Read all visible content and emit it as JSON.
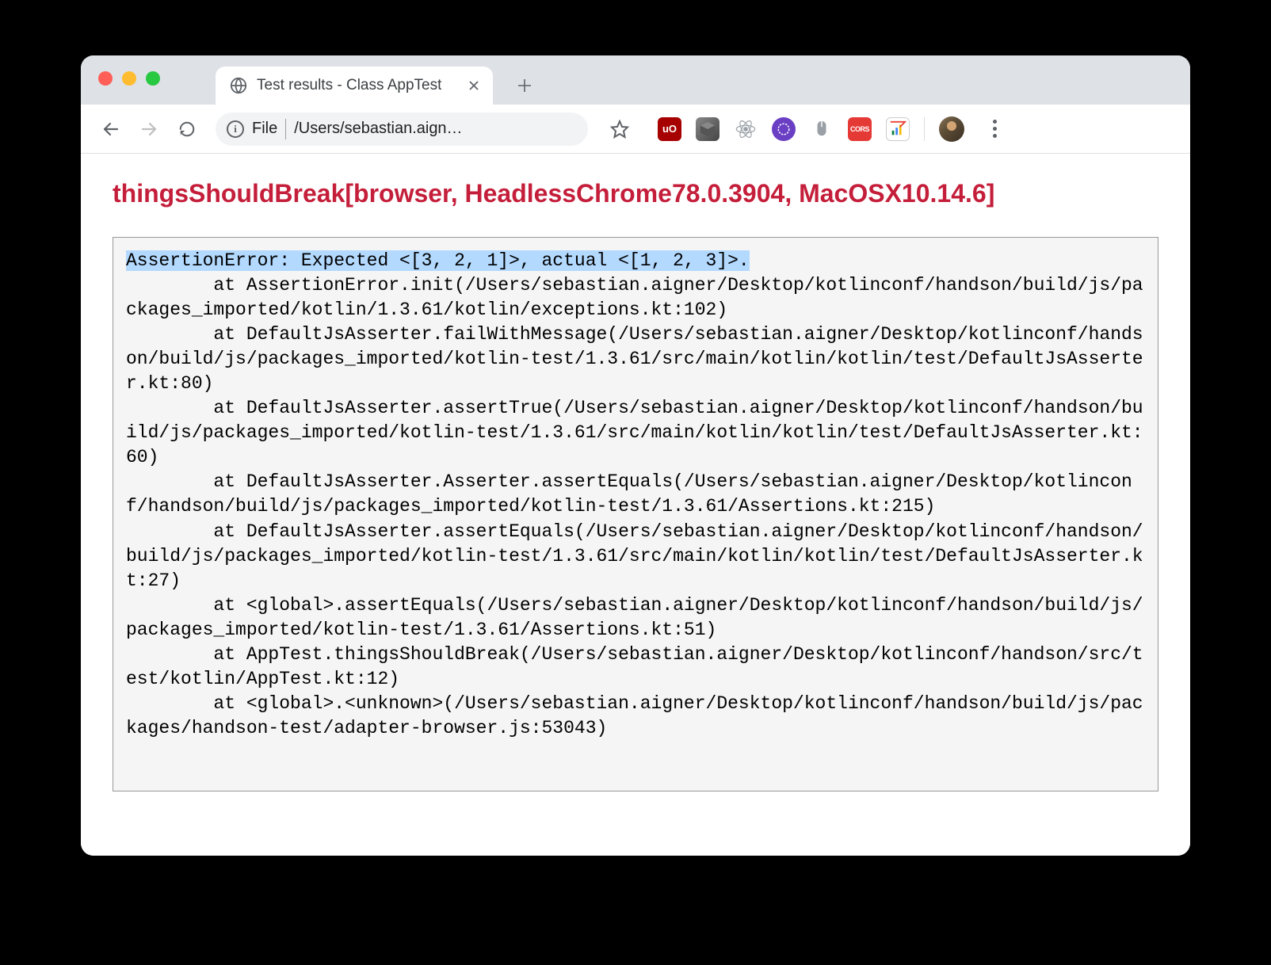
{
  "tab": {
    "title": "Test results - Class AppTest"
  },
  "address": {
    "prefix": "File",
    "url": "/Users/sebastian.aign…"
  },
  "extensions": {
    "ublock_label": "uO",
    "cors_label": "CORS"
  },
  "page": {
    "heading": "thingsShouldBreak[browser, HeadlessChrome78.0.3904, MacOSX10.14.6]",
    "error_line": "AssertionError: Expected <[3, 2, 1]>, actual <[1, 2, 3]>.",
    "stack": "        at AssertionError.init(/Users/sebastian.aigner/Desktop/kotlinconf/handson/build/js/packages_imported/kotlin/1.3.61/kotlin/exceptions.kt:102)\n        at DefaultJsAsserter.failWithMessage(/Users/sebastian.aigner/Desktop/kotlinconf/handson/build/js/packages_imported/kotlin-test/1.3.61/src/main/kotlin/kotlin/test/DefaultJsAsserter.kt:80)\n        at DefaultJsAsserter.assertTrue(/Users/sebastian.aigner/Desktop/kotlinconf/handson/build/js/packages_imported/kotlin-test/1.3.61/src/main/kotlin/kotlin/test/DefaultJsAsserter.kt:60)\n        at DefaultJsAsserter.Asserter.assertEquals(/Users/sebastian.aigner/Desktop/kotlinconf/handson/build/js/packages_imported/kotlin-test/1.3.61/Assertions.kt:215)\n        at DefaultJsAsserter.assertEquals(/Users/sebastian.aigner/Desktop/kotlinconf/handson/build/js/packages_imported/kotlin-test/1.3.61/src/main/kotlin/kotlin/test/DefaultJsAsserter.kt:27)\n        at <global>.assertEquals(/Users/sebastian.aigner/Desktop/kotlinconf/handson/build/js/packages_imported/kotlin-test/1.3.61/Assertions.kt:51)\n        at AppTest.thingsShouldBreak(/Users/sebastian.aigner/Desktop/kotlinconf/handson/src/test/kotlin/AppTest.kt:12)\n        at <global>.<unknown>(/Users/sebastian.aigner/Desktop/kotlinconf/handson/build/js/packages/handson-test/adapter-browser.js:53043)"
  }
}
